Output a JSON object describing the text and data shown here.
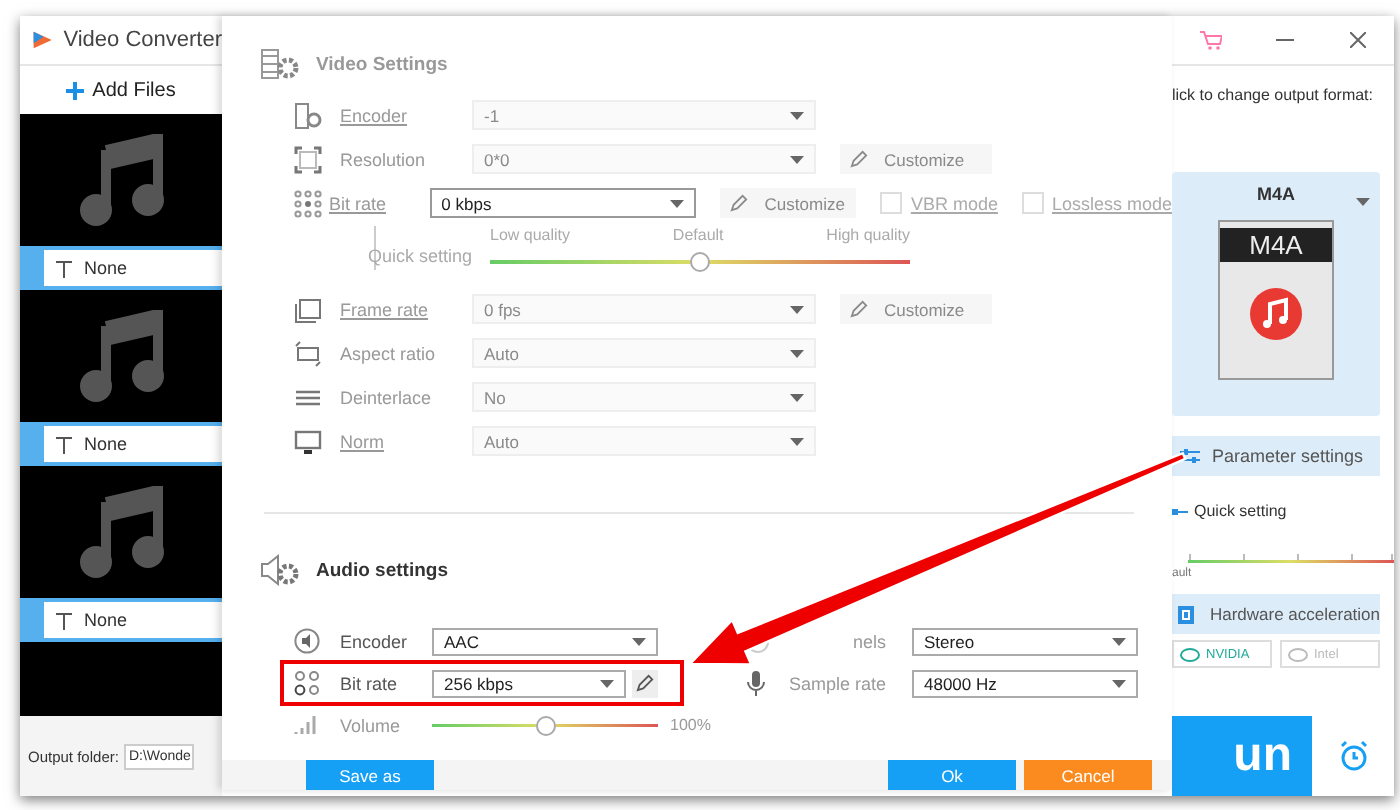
{
  "app": {
    "title": "Video Converter",
    "add_files": "Add Files",
    "files": [
      {
        "subtitle": "None"
      },
      {
        "subtitle": "None"
      },
      {
        "subtitle": "None"
      }
    ],
    "output_folder": {
      "label": "Output folder:",
      "value": "D:\\Wonde"
    }
  },
  "dialog": {
    "video_settings": {
      "title": "Video Settings",
      "rows": [
        {
          "kind": "select",
          "label": "Encoder",
          "link": true,
          "value": "-1",
          "disabled": true
        },
        {
          "kind": "select",
          "label": "Resolution",
          "link": false,
          "value": "0*0",
          "disabled": true,
          "customize": {
            "label": "Customize",
            "disabled": true
          }
        },
        {
          "kind": "select",
          "label": "Bit rate",
          "link": true,
          "value": "0 kbps",
          "disabled": false,
          "customize": {
            "label": "Customize",
            "disabled": true
          },
          "checks": [
            {
              "label": "VBR mode",
              "checked": false
            },
            {
              "label": "Lossless mode",
              "checked": false
            }
          ]
        },
        {
          "kind": "slider",
          "label": "Quick setting",
          "marks": [
            "Low quality",
            "Default",
            "High quality"
          ],
          "level": 0.5
        },
        {
          "kind": "select",
          "label": "Frame rate",
          "link": true,
          "value": "0 fps",
          "disabled": true,
          "customize": {
            "label": "Customize",
            "disabled": true
          }
        },
        {
          "kind": "select",
          "label": "Aspect ratio",
          "link": false,
          "value": "Auto",
          "disabled": true
        },
        {
          "kind": "select",
          "label": "Deinterlace",
          "link": false,
          "value": "No",
          "disabled": true
        },
        {
          "kind": "select",
          "label": "Norm",
          "link": true,
          "value": "Auto",
          "disabled": true
        }
      ]
    },
    "audio_settings": {
      "title": "Audio settings",
      "rows": [
        {
          "label": "Encoder",
          "value": "AAC",
          "highlighted": false,
          "editable": false,
          "right": {
            "label": "nels",
            "value": "Stereo"
          }
        },
        {
          "label": "Bit rate",
          "value": "256 kbps",
          "highlighted": true,
          "editable": true,
          "right": {
            "label": "Sample rate",
            "value": "48000 Hz"
          }
        }
      ],
      "volume": {
        "label": "Volume",
        "level": 0.5,
        "reading": "100%"
      }
    },
    "buttons": {
      "save_as": "Save as",
      "ok": "Ok",
      "cancel": "Cancel"
    }
  },
  "panel": {
    "hint": "lick to change output format:",
    "format": {
      "name": "M4A",
      "icon_label": "M4A"
    },
    "parameter_settings": "Parameter settings",
    "quick_setting": "Quick setting",
    "slider_label": "ault",
    "hardware_acceleration": {
      "label": "Hardware acceleration",
      "checked": true
    },
    "gpus": [
      {
        "label": "NVIDIA",
        "disabled": false
      },
      {
        "label": "Intel",
        "disabled": true
      }
    ],
    "run_button": "un"
  }
}
